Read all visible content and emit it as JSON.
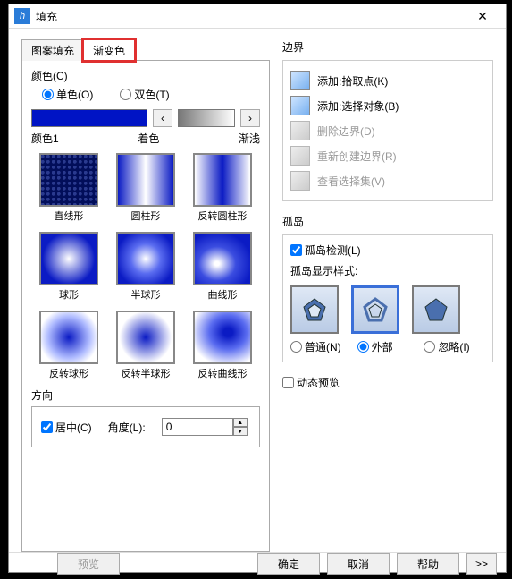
{
  "window": {
    "title": "填充"
  },
  "tabs": {
    "pattern": "图案填充",
    "gradient": "渐变色"
  },
  "color": {
    "label": "颜色(C)",
    "one": "单色(O)",
    "two": "双色(T)",
    "c1": "颜色1",
    "tint": "着色",
    "shade": "渐浅"
  },
  "arrows": {
    "left": "‹",
    "right": "›"
  },
  "swatches": [
    "直线形",
    "圆柱形",
    "反转圆柱形",
    "球形",
    "半球形",
    "曲线形",
    "反转球形",
    "反转半球形",
    "反转曲线形"
  ],
  "direction": {
    "label": "方向",
    "center": "居中(C)",
    "angle": "角度(L):",
    "value": "0"
  },
  "boundary": {
    "title": "边界",
    "items": [
      "添加:拾取点(K)",
      "添加:选择对象(B)",
      "删除边界(D)",
      "重新创建边界(R)",
      "查看选择集(V)"
    ]
  },
  "island": {
    "title": "孤岛",
    "detect": "孤岛检测(L)",
    "style": "孤岛显示样式:",
    "modes": [
      "普通(N)",
      "外部",
      "忽略(I)"
    ]
  },
  "dynamic": "动态预览",
  "footer": {
    "preview": "预览",
    "ok": "确定",
    "cancel": "取消",
    "help": "帮助",
    "more": ">>"
  }
}
